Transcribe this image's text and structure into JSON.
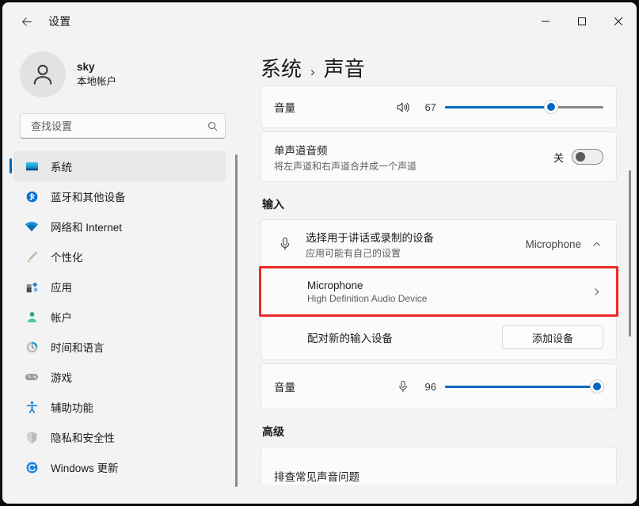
{
  "window": {
    "app_title": "设置",
    "back_icon": "back-arrow-icon",
    "controls": {
      "minimize": "–",
      "maximize": "▢",
      "close": "✕"
    }
  },
  "account": {
    "name": "sky",
    "subtitle": "本地帐户",
    "avatar_icon": "person-avatar-icon"
  },
  "search": {
    "placeholder": "查找设置",
    "value": "",
    "icon": "search-icon"
  },
  "sidebar": {
    "items": [
      {
        "label": "系统",
        "icon": "system-monitor-icon",
        "selected": true
      },
      {
        "label": "蓝牙和其他设备",
        "icon": "bluetooth-icon",
        "selected": false
      },
      {
        "label": "网络和 Internet",
        "icon": "wifi-icon",
        "selected": false
      },
      {
        "label": "个性化",
        "icon": "paintbrush-icon",
        "selected": false
      },
      {
        "label": "应用",
        "icon": "apps-icon",
        "selected": false
      },
      {
        "label": "帐户",
        "icon": "account-person-icon",
        "selected": false
      },
      {
        "label": "时间和语言",
        "icon": "clock-icon",
        "selected": false
      },
      {
        "label": "游戏",
        "icon": "gamepad-icon",
        "selected": false
      },
      {
        "label": "辅助功能",
        "icon": "accessibility-icon",
        "selected": false
      },
      {
        "label": "隐私和安全性",
        "icon": "shield-icon",
        "selected": false
      },
      {
        "label": "Windows 更新",
        "icon": "update-refresh-icon",
        "selected": false
      }
    ]
  },
  "page": {
    "breadcrumb_root": "系统",
    "breadcrumb_sep": "›",
    "breadcrumb_current": "声音"
  },
  "output_volume": {
    "label": "音量",
    "icon": "speaker-volume-icon",
    "value": "67",
    "percent": 67
  },
  "mono_audio": {
    "title": "单声道音频",
    "subtitle": "将左声道和右声道合并成一个声道",
    "state_label": "关",
    "enabled": false
  },
  "input_section": {
    "heading": "输入",
    "choose_device": {
      "title": "选择用于讲话或录制的设备",
      "subtitle": "应用可能有自己的设置",
      "icon": "microphone-icon",
      "selected_value": "Microphone",
      "chevron": "chevron-up-icon"
    },
    "device_item": {
      "title": "Microphone",
      "subtitle": "High Definition Audio Device",
      "chevron": "chevron-right-icon",
      "highlighted": true,
      "highlight_color": "#ef2929"
    },
    "pair_device": {
      "label": "配对新的输入设备",
      "button_label": "添加设备"
    },
    "input_volume": {
      "label": "音量",
      "icon": "microphone-icon",
      "value": "96",
      "percent": 96
    }
  },
  "advanced_section": {
    "heading": "高级",
    "troubleshoot_label": "排查常见声音问题"
  },
  "colors": {
    "accent": "#0067c0",
    "highlight": "#ef2929",
    "window_bg": "#f3f3f3",
    "card_bg": "#fbfbfb"
  }
}
